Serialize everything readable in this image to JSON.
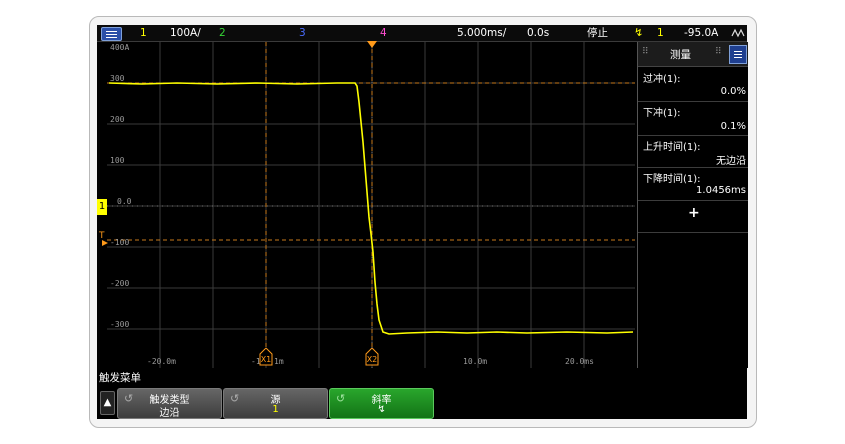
{
  "top_bar": {
    "ch1_num": "1",
    "ch1_scale": "100A/",
    "ch2_num": "2",
    "ch3_num": "3",
    "ch4_num": "4",
    "timebase": "5.000ms/",
    "delay": "0.0s",
    "run_state": "停止",
    "trigger_source": "1",
    "trigger_level": "-95.0A",
    "trigger_slope_icon": "falling-edge-icon",
    "wave_icon": "wave-icon"
  },
  "grid": {
    "y_ticks": [
      "400A",
      "300",
      "200",
      "100",
      "0.0",
      "-100",
      "-200",
      "-300"
    ],
    "x_ticks": [
      "-20.0m",
      "-1",
      "1m",
      "10.0m",
      "20.0ms"
    ],
    "cursor_x1": "X1",
    "cursor_x2": "X2",
    "ground_marker": "1",
    "trigger_level_marker": "T"
  },
  "measure_panel": {
    "title": "测量",
    "items": [
      {
        "label": "过冲(1):",
        "value": "0.0%"
      },
      {
        "label": "下冲(1):",
        "value": "0.1%"
      },
      {
        "label": "上升时间(1):",
        "value": "无边沿"
      },
      {
        "label": "下降时间(1):",
        "value": "1.0456ms"
      }
    ],
    "add_label": "+"
  },
  "softkeys": {
    "menu_title": "触发菜单",
    "keys": [
      {
        "title": "触发类型",
        "value": "边沿"
      },
      {
        "title": "源",
        "value": "1"
      },
      {
        "title": "斜率",
        "value": "↯"
      }
    ]
  },
  "colors": {
    "ch1": "#ffff00",
    "ch2": "#35d435",
    "ch3": "#4a6cff",
    "ch4": "#ff4dd2",
    "accent": "#ff9a1a"
  }
}
